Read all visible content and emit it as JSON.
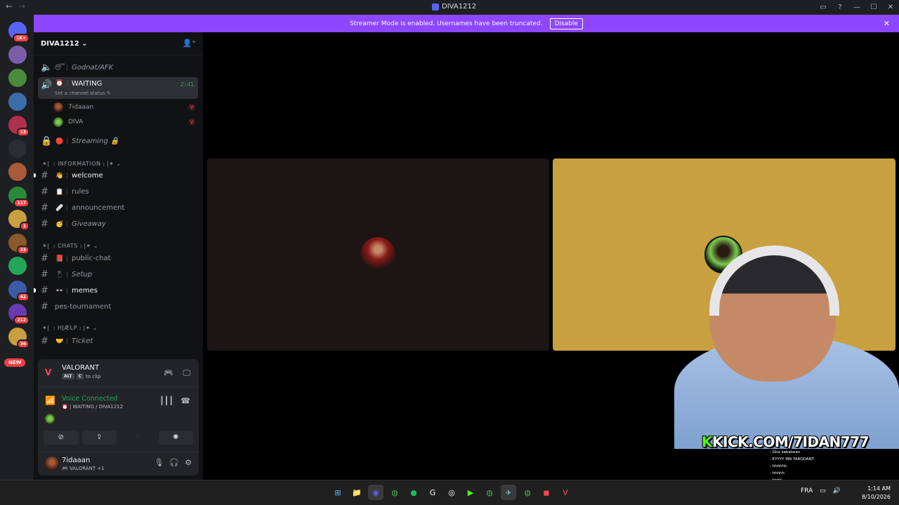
{
  "window": {
    "title": "DIVA1212",
    "back_icon": "←",
    "forward_icon": "→"
  },
  "banner": {
    "text": "Streamer Mode is enabled. Usernames have been truncated.",
    "button": "Disable",
    "close": "✕",
    "color": "#8c47ff"
  },
  "servers": [
    {
      "badge": "1K+"
    },
    {
      "badge": ""
    },
    {
      "badge": ""
    },
    {
      "badge": ""
    },
    {
      "badge": "13"
    },
    {
      "badge": ""
    },
    {
      "badge": ""
    },
    {
      "badge": "117"
    },
    {
      "badge": "1"
    },
    {
      "badge": "33"
    },
    {
      "badge": ""
    },
    {
      "badge": "42"
    },
    {
      "badge": "212"
    },
    {
      "badge": "36"
    }
  ],
  "new_badge": "NEW",
  "sidebar": {
    "guild_name": "DIVA1212",
    "chevron": "⌄",
    "channels": [
      {
        "type": "voice",
        "emoji": "😴",
        "label": "Godnat/AFK",
        "italic": true
      },
      {
        "type": "voice-active",
        "emoji": "⏰",
        "label": "WAITING",
        "timer": "2:41",
        "status": "Set a channel status ✎"
      },
      {
        "type": "locked",
        "emoji": "🔴",
        "label": "Streaming 🔒",
        "italic": true
      }
    ],
    "voice_users": [
      {
        "name": "7idaaan"
      },
      {
        "name": "DIVA"
      }
    ],
    "categories": [
      {
        "label": "✶| ﹝INFORMATION﹞|✶ ⌄"
      },
      {
        "label": "✶| ﹝CHATS﹞|✶ ⌄"
      },
      {
        "label": "✶| ﹝HJÆLP﹞|✶ ⌄"
      }
    ],
    "text_channels": [
      {
        "emoji": "👋",
        "label": "welcome",
        "bright": true,
        "italic": false
      },
      {
        "emoji": "📋",
        "label": "rules",
        "bright": false,
        "italic": false
      },
      {
        "emoji": "🩹",
        "label": "announcement",
        "bright": false,
        "italic": false
      },
      {
        "emoji": "🥳",
        "label": "Giveaway",
        "bright": false,
        "italic": true
      },
      {
        "emoji": "📕",
        "label": "public-chat",
        "bright": false,
        "italic": false
      },
      {
        "emoji": "📱",
        "label": "Setup",
        "bright": false,
        "italic": true
      },
      {
        "emoji": "👓",
        "label": "memes",
        "bright": true,
        "italic": false
      },
      {
        "emoji": "",
        "label": "pes-tournament",
        "bright": false,
        "italic": false
      },
      {
        "emoji": "🤝",
        "label": "Ticket",
        "bright": false,
        "italic": true
      }
    ]
  },
  "panel": {
    "game": {
      "name": "VALORANT",
      "key1": "ALT",
      "key2": "C",
      "hint": "to clip"
    },
    "voice": {
      "title": "Voice Connected",
      "subtitle": "⏰ | WAITING / DIVA1212"
    },
    "user": {
      "name": "7idaaan",
      "status": "🎮 VALORANT +1"
    }
  },
  "stream": {
    "kick_text": "KICK.COM/7IDAN777",
    "chat_lines": [
      {
        "name": "",
        "text": ": Gha kabatwan"
      },
      {
        "name": "",
        "text": ""
      },
      {
        "name": "",
        "text": ": EYYYY MN TARODANT"
      },
      {
        "name": "",
        "text": ""
      },
      {
        "name": "",
        "text": ": hhhhhh"
      },
      {
        "name": "",
        "text": ": hhhhh"
      },
      {
        "name": "",
        "text": ": hhhh"
      }
    ]
  },
  "taskbar": {
    "lang": "FRA",
    "time": "1:14 AM",
    "date": "8/10/2026"
  },
  "colors": {
    "green": "#23a55a",
    "valorant": "#ff4655",
    "tile_gold": "#c9a03f"
  }
}
